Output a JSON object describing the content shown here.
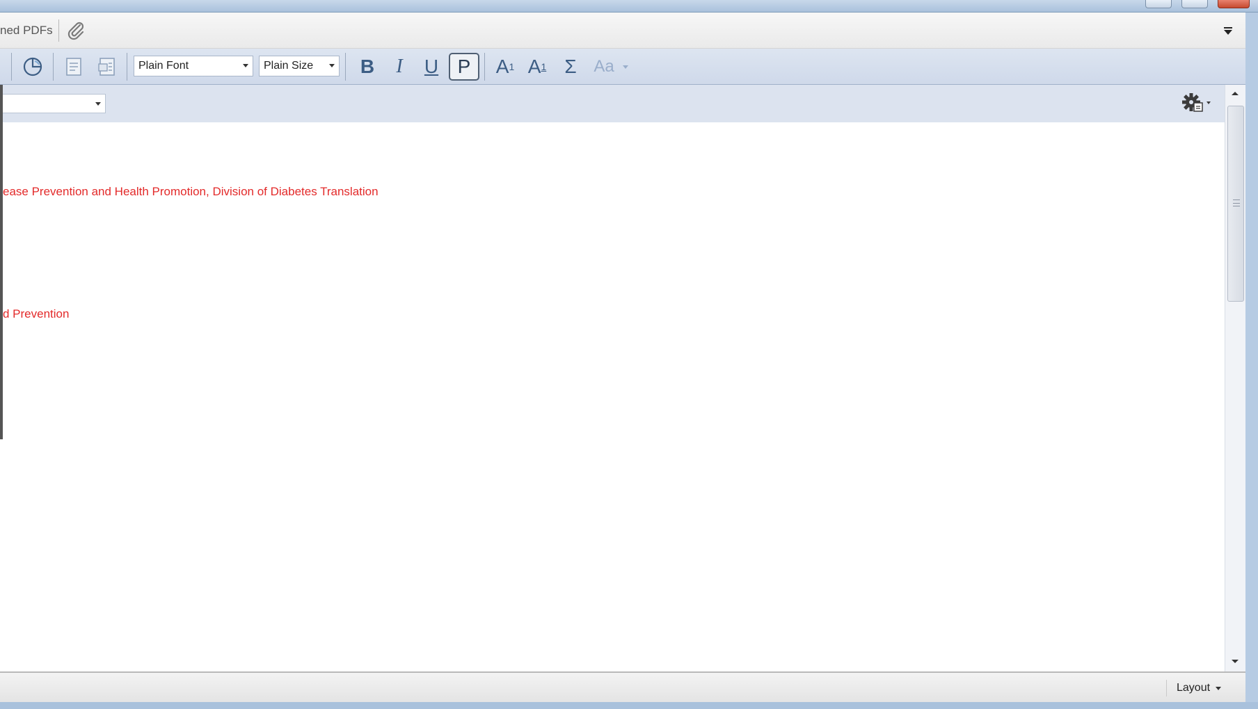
{
  "tabs": {
    "partial_tab_label": "ned PDFs"
  },
  "toolbar": {
    "font_combo": "Plain Font",
    "size_combo": "Plain Size",
    "bold": "B",
    "italic": "I",
    "underline": "U",
    "plain": "P",
    "superscript_base": "A",
    "superscript_mark": "1",
    "subscript_base": "A",
    "subscript_mark": "1",
    "symbol": "Σ",
    "case_change": "Aa"
  },
  "content": {
    "line1": "ease Prevention and Health Promotion, Division of Diabetes Translation",
    "line2": "d Prevention"
  },
  "statusbar": {
    "layout_label": "Layout"
  },
  "colors": {
    "reference_text": "#e32a2a",
    "toolbar_icon": "#3c5d84"
  }
}
